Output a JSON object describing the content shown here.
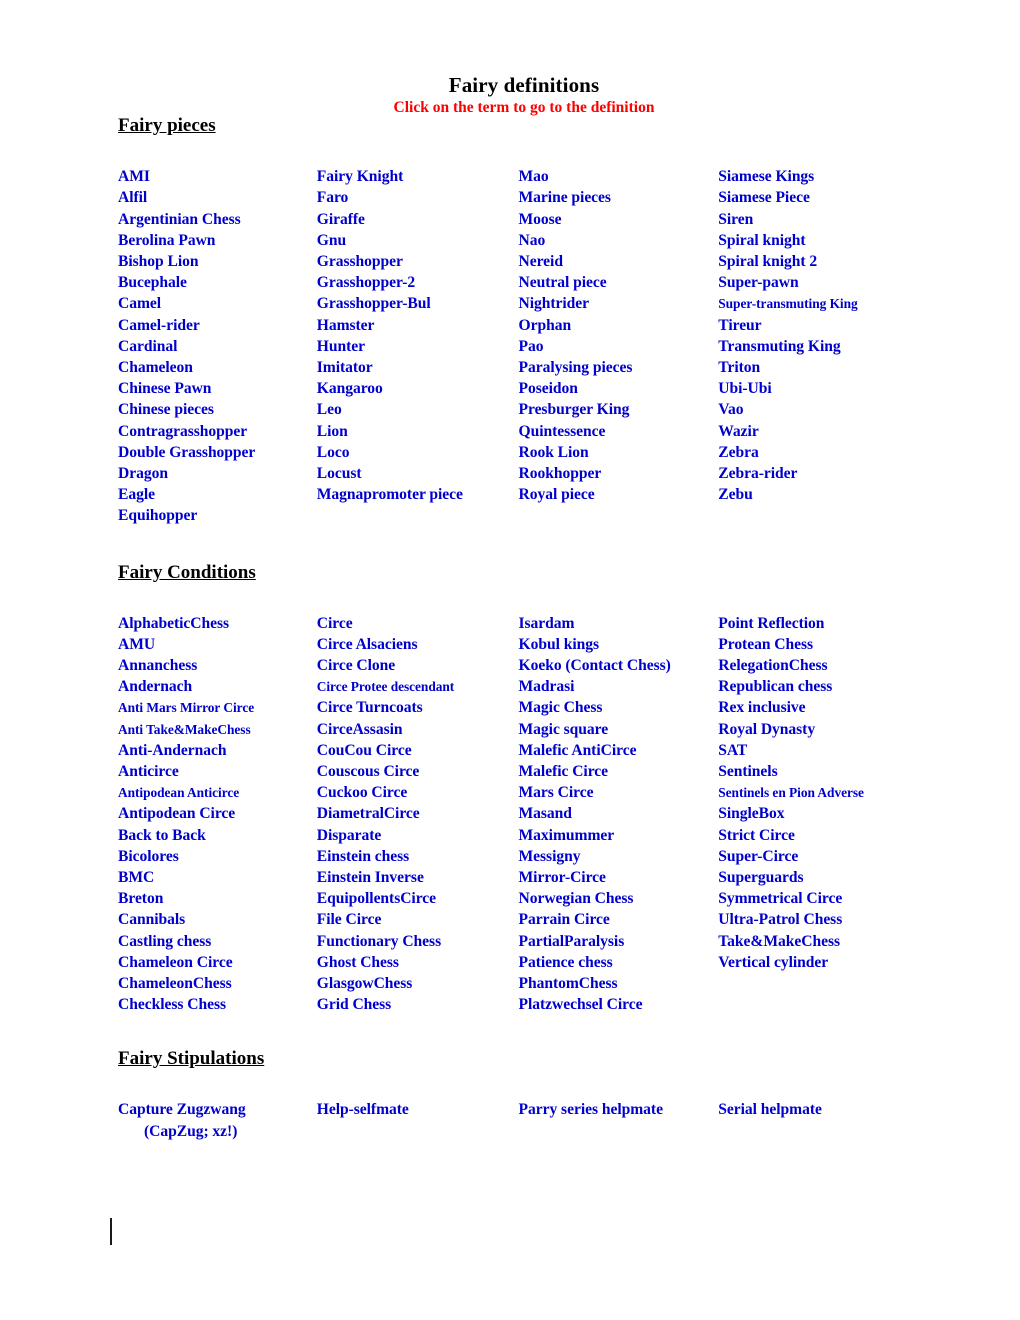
{
  "header": {
    "title": "Fairy definitions",
    "subtitle": "Click on the term to go to the definition",
    "title_color": "#000000",
    "subtitle_color": "#ff0000",
    "link_color": "#0000cc"
  },
  "sections": [
    {
      "heading": "Fairy pieces",
      "columns": [
        [
          {
            "label": "AMI"
          },
          {
            "label": "Alfil"
          },
          {
            "label": "Argentinian Chess"
          },
          {
            "label": "Berolina Pawn"
          },
          {
            "label": "Bishop Lion"
          },
          {
            "label": "Bucephale"
          },
          {
            "label": "Camel"
          },
          {
            "label": "Camel-rider"
          },
          {
            "label": "Cardinal"
          },
          {
            "label": "Chameleon"
          },
          {
            "label": "Chinese Pawn"
          },
          {
            "label": "Chinese pieces"
          },
          {
            "label": "Contragrasshopper"
          },
          {
            "label": "Double Grasshopper"
          },
          {
            "label": "Dragon"
          },
          {
            "label": "Eagle"
          },
          {
            "label": "Equihopper"
          }
        ],
        [
          {
            "label": "Fairy Knight"
          },
          {
            "label": "Faro"
          },
          {
            "label": "Giraffe"
          },
          {
            "label": "Gnu"
          },
          {
            "label": "Grasshopper"
          },
          {
            "label": "Grasshopper-2"
          },
          {
            "label": "Grasshopper-Bul"
          },
          {
            "label": "Hamster"
          },
          {
            "label": "Hunter"
          },
          {
            "label": "Imitator"
          },
          {
            "label": "Kangaroo"
          },
          {
            "label": "Leo"
          },
          {
            "label": "Lion"
          },
          {
            "label": "Loco"
          },
          {
            "label": "Locust"
          },
          {
            "label": "Magnapromoter piece"
          }
        ],
        [
          {
            "label": "Mao"
          },
          {
            "label": "Marine pieces"
          },
          {
            "label": "Moose"
          },
          {
            "label": "Nao"
          },
          {
            "label": "Nereid"
          },
          {
            "label": "Neutral piece"
          },
          {
            "label": "Nightrider"
          },
          {
            "label": "Orphan"
          },
          {
            "label": "Pao"
          },
          {
            "label": "Paralysing pieces"
          },
          {
            "label": "Poseidon"
          },
          {
            "label": "Presburger King"
          },
          {
            "label": "Quintessence"
          },
          {
            "label": "Rook Lion"
          },
          {
            "label": "Rookhopper"
          },
          {
            "label": "Royal piece"
          }
        ],
        [
          {
            "label": "Siamese Kings"
          },
          {
            "label": "Siamese Piece"
          },
          {
            "label": "Siren"
          },
          {
            "label": "Spiral knight"
          },
          {
            "label": "Spiral knight 2"
          },
          {
            "label": "Super-pawn"
          },
          {
            "label": "Super-transmuting  King",
            "small": true
          },
          {
            "label": "Tireur"
          },
          {
            "label": "Transmuting King"
          },
          {
            "label": "Triton"
          },
          {
            "label": "Ubi-Ubi"
          },
          {
            "label": "Vao"
          },
          {
            "label": "Wazir"
          },
          {
            "label": "Zebra"
          },
          {
            "label": "Zebra-rider"
          },
          {
            "label": "Zebu"
          }
        ]
      ]
    },
    {
      "heading": "Fairy Conditions",
      "columns": [
        [
          {
            "label": "AlphabeticChess"
          },
          {
            "label": "AMU"
          },
          {
            "label": "Annanchess"
          },
          {
            "label": "Andernach"
          },
          {
            "label": "Anti Mars Mirror Circe",
            "small": true
          },
          {
            "label": "Anti Take&MakeChess",
            "small": true
          },
          {
            "label": "Anti-Andernach"
          },
          {
            "label": "Anticirce"
          },
          {
            "label": "Antipodean Anticirce",
            "small": true
          },
          {
            "label": "Antipodean Circe"
          },
          {
            "label": "Back to Back"
          },
          {
            "label": "Bicolores"
          },
          {
            "label": "BMC"
          },
          {
            "label": "Breton"
          },
          {
            "label": "Cannibals"
          },
          {
            "label": "Castling chess"
          },
          {
            "label": "Chameleon Circe"
          },
          {
            "label": "ChameleonChess"
          },
          {
            "label": "Checkless Chess"
          }
        ],
        [
          {
            "label": "Circe"
          },
          {
            "label": "Circe Alsaciens"
          },
          {
            "label": "Circe Clone"
          },
          {
            "label": "Circe Protee descendant",
            "small": true
          },
          {
            "label": "Circe Turncoats"
          },
          {
            "label": "CirceAssasin"
          },
          {
            "label": "CouCou Circe"
          },
          {
            "label": "Couscous Circe"
          },
          {
            "label": "Cuckoo Circe"
          },
          {
            "label": "DiametralCirce"
          },
          {
            "label": "Disparate"
          },
          {
            "label": "Einstein chess"
          },
          {
            "label": "Einstein Inverse"
          },
          {
            "label": "EquipollentsCirce"
          },
          {
            "label": "File Circe"
          },
          {
            "label": "Functionary Chess"
          },
          {
            "label": "Ghost Chess"
          },
          {
            "label": "GlasgowChess"
          },
          {
            "label": "Grid Chess"
          }
        ],
        [
          {
            "label": "Isardam"
          },
          {
            "label": "Kobul kings"
          },
          {
            "label": "Koeko (Contact Chess)"
          },
          {
            "label": "Madrasi"
          },
          {
            "label": "Magic Chess"
          },
          {
            "label": "Magic square"
          },
          {
            "label": "Malefic AntiCirce"
          },
          {
            "label": "Malefic Circe"
          },
          {
            "label": "Mars Circe"
          },
          {
            "label": "Masand"
          },
          {
            "label": "Maximummer"
          },
          {
            "label": "Messigny"
          },
          {
            "label": "Mirror-Circe"
          },
          {
            "label": "Norwegian Chess"
          },
          {
            "label": "Parrain Circe"
          },
          {
            "label": "PartialParalysis"
          },
          {
            "label": "Patience chess"
          },
          {
            "label": "PhantomChess"
          },
          {
            "label": "Platzwechsel Circe"
          }
        ],
        [
          {
            "label": "Point Reflection"
          },
          {
            "label": "Protean Chess"
          },
          {
            "label": "RelegationChess"
          },
          {
            "label": "Republican chess"
          },
          {
            "label": "Rex inclusive"
          },
          {
            "label": "Royal Dynasty"
          },
          {
            "label": "SAT"
          },
          {
            "label": "Sentinels"
          },
          {
            "label": "Sentinels en Pion Adverse",
            "small": true
          },
          {
            "label": "SingleBox"
          },
          {
            "label": "Strict Circe"
          },
          {
            "label": "Super-Circe"
          },
          {
            "label": "Superguards"
          },
          {
            "label": "Symmetrical Circe"
          },
          {
            "label": "Ultra-Patrol Chess"
          },
          {
            "label": "Take&MakeChess"
          },
          {
            "label": "Vertical cylinder"
          }
        ]
      ]
    },
    {
      "heading": "Fairy Stipulations",
      "columns": [
        [
          {
            "label": "Capture Zugzwang",
            "sub": "(CapZug; xz!)"
          }
        ],
        [
          {
            "label": "Help-selfmate"
          }
        ],
        [
          {
            "label": "Parry series helpmate"
          }
        ],
        [
          {
            "label": "Serial helpmate"
          }
        ]
      ]
    }
  ]
}
